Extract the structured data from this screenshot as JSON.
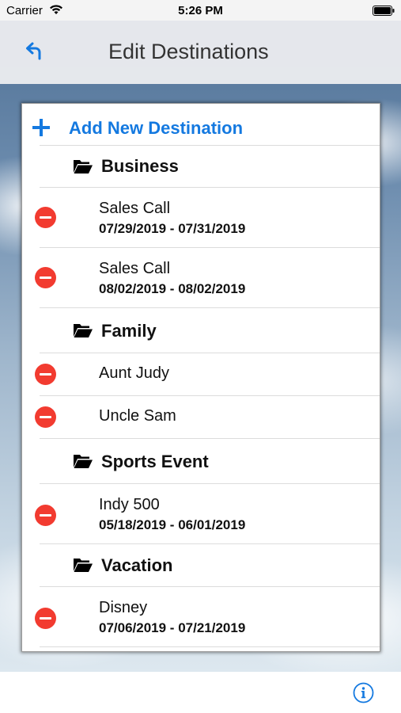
{
  "status_bar": {
    "carrier": "Carrier",
    "time": "5:26 PM"
  },
  "nav": {
    "title": "Edit Destinations",
    "back_icon": "undo-arrow-icon"
  },
  "list": {
    "add_label": "Add New Destination",
    "groups": [
      {
        "name": "Business",
        "items": [
          {
            "name": "Sales Call",
            "dates": "07/29/2019 - 07/31/2019"
          },
          {
            "name": "Sales Call",
            "dates": "08/02/2019 - 08/02/2019"
          }
        ]
      },
      {
        "name": "Family",
        "items": [
          {
            "name": "Aunt Judy",
            "dates": ""
          },
          {
            "name": "Uncle Sam",
            "dates": ""
          }
        ]
      },
      {
        "name": "Sports Event",
        "items": [
          {
            "name": "Indy 500",
            "dates": "05/18/2019 - 06/01/2019"
          }
        ]
      },
      {
        "name": "Vacation",
        "items": [
          {
            "name": "Disney",
            "dates": "07/06/2019 - 07/21/2019"
          }
        ]
      }
    ]
  },
  "colors": {
    "accent": "#1479e0",
    "delete": "#f23b30"
  }
}
